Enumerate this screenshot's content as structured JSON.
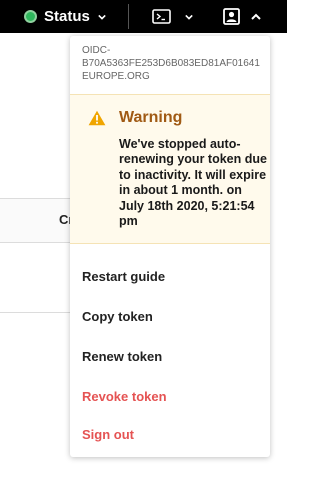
{
  "topbar": {
    "status_label": "Status",
    "status_color": "#2eb85c",
    "terminal_icon": "terminal-icon",
    "user_icon": "user-portrait-icon"
  },
  "background": {
    "partial_text": "Cr"
  },
  "dropdown": {
    "user_id_lines": [
      "OIDC-",
      "B70A5363FE253D6B083ED81AF01641",
      "EUROPE.ORG"
    ],
    "warning": {
      "title": "Warning",
      "icon": "warning-triangle-icon",
      "message": "We've stopped auto-renewing your token due to inactivity. It will expire in about 1 month. on July 18th 2020, 5:21:54 pm"
    },
    "items": [
      {
        "label": "Restart guide",
        "danger": false
      },
      {
        "label": "Copy token",
        "danger": false
      },
      {
        "label": "Renew token",
        "danger": false
      },
      {
        "label": "Revoke token",
        "danger": true
      },
      {
        "label": "Sign out",
        "danger": true
      }
    ]
  },
  "colors": {
    "danger": "#e55353",
    "warning_title": "#a05a14",
    "warning_icon": "#f0a500"
  }
}
